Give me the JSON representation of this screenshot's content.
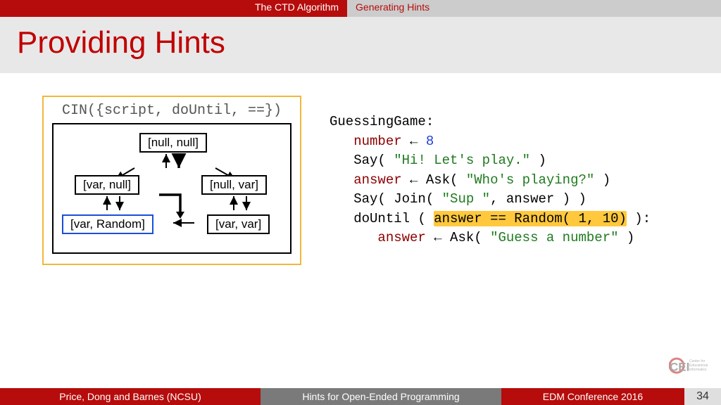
{
  "topbar": {
    "section": "The CTD Algorithm",
    "subsection": "Generating Hints"
  },
  "title": "Providing Hints",
  "diagram": {
    "cin_label": "CIN({script, doUntil, ==})",
    "nodes": {
      "top": "[null, null]",
      "left1": "[var, null]",
      "right1": "[null, var]",
      "left2": "[var, Random]",
      "right2": "[var, var]"
    }
  },
  "code": {
    "l1": "GuessingGame:",
    "l2a": "number",
    "l2b": " ← ",
    "l2c": "8",
    "l3a": "Say( ",
    "l3b": "\"Hi! Let's play.\"",
    "l3c": " )",
    "l4a": "answer",
    "l4b": " ← Ask( ",
    "l4c": "\"Who's playing?\"",
    "l4d": " )",
    "l5a": "Say( Join( ",
    "l5b": "\"Sup \"",
    "l5c": ", answer ) )",
    "l6a": "doUntil ( ",
    "l6h": "answer == Random( 1, 10)",
    "l6b": " ):",
    "l7a": "answer",
    "l7b": " ← Ask( ",
    "l7c": "\"Guess a number\"",
    "l7d": " )"
  },
  "footer": {
    "authors": "Price, Dong and Barnes (NCSU)",
    "title": "Hints for Open-Ended Programming",
    "venue": "EDM Conference 2016",
    "page": "34"
  },
  "logo": {
    "main": "CEI",
    "sub1": "Center for",
    "sub2": "Educational",
    "sub3": "Informatics"
  }
}
